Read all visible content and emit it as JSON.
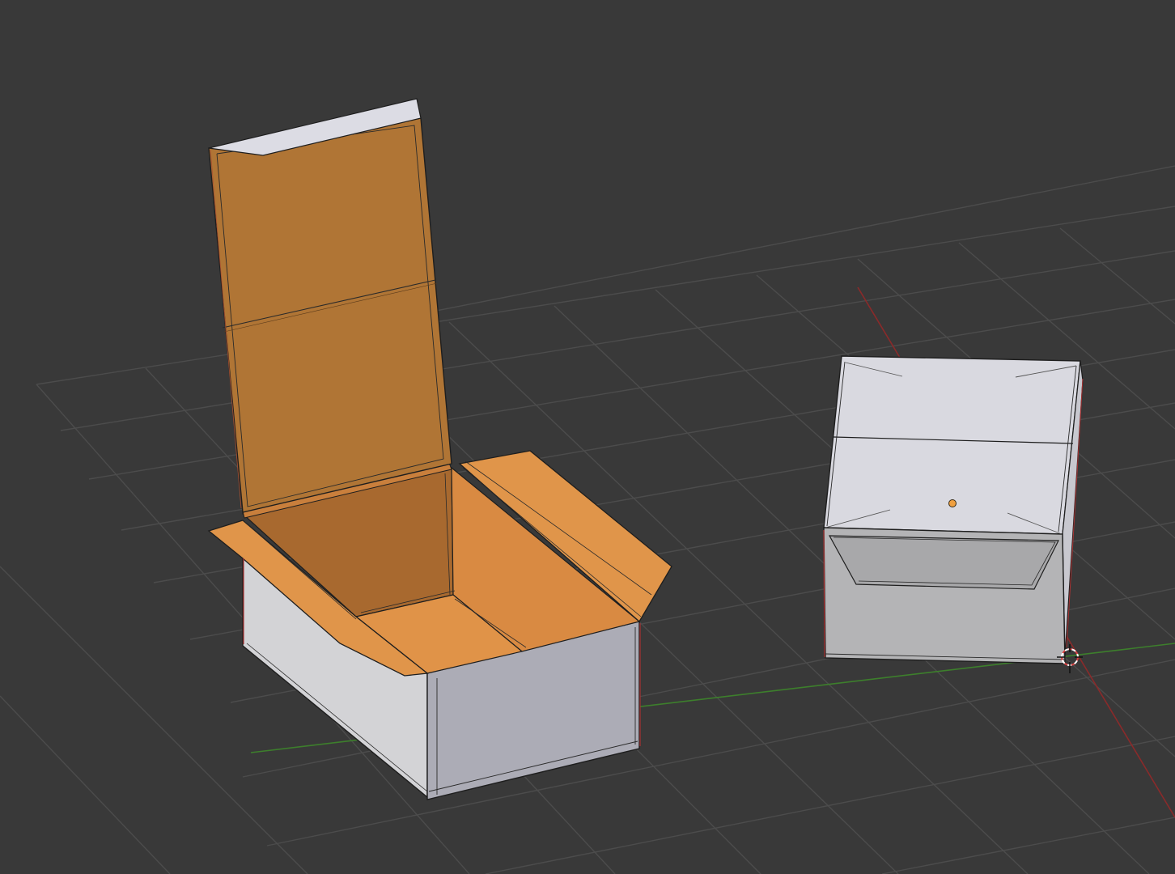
{
  "viewport": {
    "background_color": "#393939",
    "grid_color": "#4a4a4a",
    "x_axis_color": "#8a2a2a",
    "y_axis_color": "#3f7d2a"
  },
  "objects": [
    {
      "name": "open-carton-box",
      "inner_color": "#de9148",
      "outer_color": "#d8d8dc",
      "selected": true
    },
    {
      "name": "closed-carton-box",
      "outer_color": "#d6d6dc",
      "selected": false
    }
  ],
  "markers": {
    "object_origin_color": "#f0a040",
    "cursor_3d": "3d-cursor-icon"
  }
}
